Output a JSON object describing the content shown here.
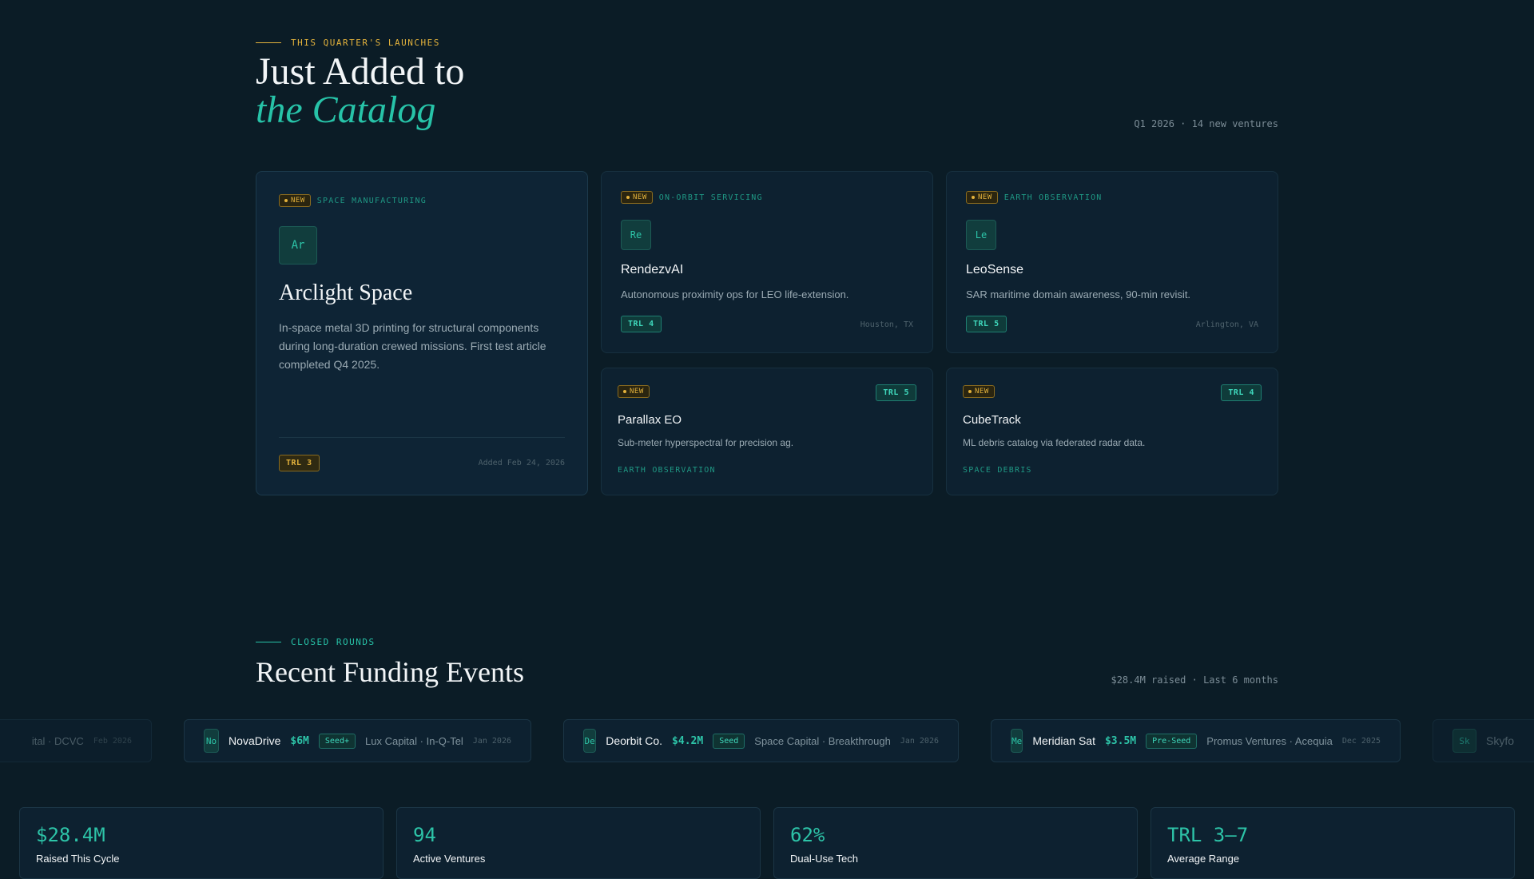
{
  "launches": {
    "eyebrow": "THIS QUARTER'S LAUNCHES",
    "title_line1": "Just Added to",
    "title_line2": "the Catalog",
    "meta": "Q1 2026 · 14 new ventures",
    "featured": {
      "badge": "NEW",
      "category": "SPACE MANUFACTURING",
      "avatar": "Ar",
      "name": "Arclight Space",
      "description": "In-space metal 3D printing for structural components during long-duration crewed missions. First test article completed Q4 2025.",
      "trl": "TRL 3",
      "added": "Added Feb 24, 2026"
    },
    "cards": [
      {
        "badge": "NEW",
        "category": "ON-ORBIT SERVICING",
        "avatar": "Re",
        "name": "RendezvAI",
        "description": "Autonomous proximity ops for LEO life-extension.",
        "trl": "TRL 4",
        "location": "Houston, TX"
      },
      {
        "badge": "NEW",
        "category": "EARTH OBSERVATION",
        "avatar": "Le",
        "name": "LeoSense",
        "description": "SAR maritime domain awareness, 90-min revisit.",
        "trl": "TRL 5",
        "location": "Arlington, VA"
      },
      {
        "badge": "NEW",
        "trl": "TRL 5",
        "name": "Parallax EO",
        "description": "Sub-meter hyperspectral for precision ag.",
        "category": "EARTH OBSERVATION"
      },
      {
        "badge": "NEW",
        "trl": "TRL 4",
        "name": "CubeTrack",
        "description": "ML debris catalog via federated radar data.",
        "category": "SPACE DEBRIS"
      }
    ]
  },
  "funding": {
    "eyebrow": "CLOSED ROUNDS",
    "title": "Recent Funding Events",
    "meta": "$28.4M raised · Last 6 months",
    "partial_left": {
      "investors": "ital · DCVC",
      "date": "Feb 2026"
    },
    "events": [
      {
        "avatar": "No",
        "name": "NovaDrive",
        "amount": "$6M",
        "stage": "Seed+",
        "investors": "Lux Capital · In-Q-Tel",
        "date": "Jan 2026"
      },
      {
        "avatar": "De",
        "name": "Deorbit Co.",
        "amount": "$4.2M",
        "stage": "Seed",
        "investors": "Space Capital · Breakthrough",
        "date": "Jan 2026"
      },
      {
        "avatar": "Me",
        "name": "Meridian Sat",
        "amount": "$3.5M",
        "stage": "Pre-Seed",
        "investors": "Promus Ventures · Acequia",
        "date": "Dec 2025"
      }
    ],
    "partial_right": {
      "avatar": "Sk",
      "name": "Skyfo"
    }
  },
  "stats": [
    {
      "value": "$28.4M",
      "label": "Raised This Cycle"
    },
    {
      "value": "94",
      "label": "Active Ventures"
    },
    {
      "value": "62%",
      "label": "Dual-Use Tech"
    },
    {
      "value": "TRL 3–7",
      "label": "Average Range"
    }
  ],
  "colors": {
    "background": "#0b1c26",
    "accent": "#27c3a8",
    "gold": "#e3b23c"
  }
}
